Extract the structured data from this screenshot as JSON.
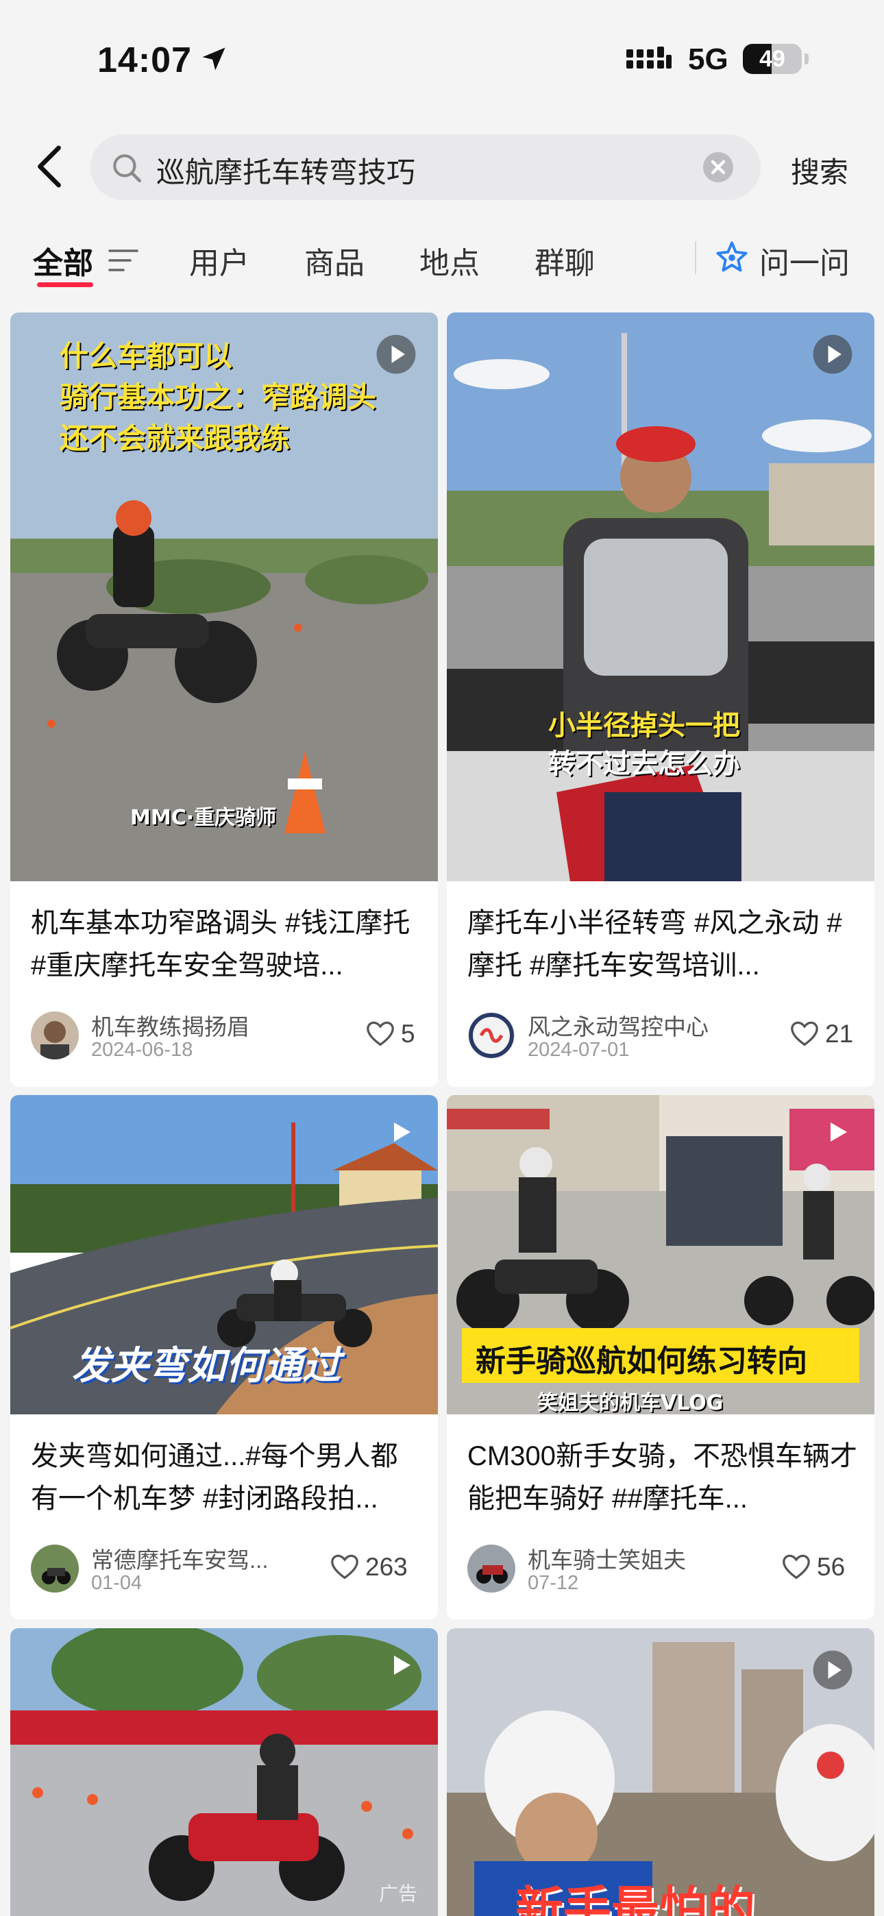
{
  "status_bar": {
    "time": "14:07",
    "network": "5G",
    "battery": "49",
    "battery_level": 0.49
  },
  "search": {
    "query": "巡航摩托车转弯技巧",
    "button_label": "搜索"
  },
  "tabs": [
    {
      "label": "全部",
      "active": true
    },
    {
      "label": "用户"
    },
    {
      "label": "商品"
    },
    {
      "label": "地点"
    },
    {
      "label": "群聊"
    }
  ],
  "ask_label": "问一问",
  "cards": [
    {
      "overlay_lines": [
        "什么车都可以",
        "骑行基本功之：窄路调头",
        "还不会就来跟我练"
      ],
      "watermark": "MMC·重庆骑师",
      "title": "机车基本功窄路调头 #钱江摩托  #重庆摩托车安全驾驶培...",
      "author": "机车教练揭扬眉",
      "date": "2024-06-18",
      "likes": "5"
    },
    {
      "overlay_lines": [
        "小半径掉头一把",
        "转不过去怎么办"
      ],
      "title": "摩托车小半径转弯 #风之永动  #摩托  #摩托车安驾培训...",
      "author": "风之永动驾控中心",
      "date": "2024-07-01",
      "likes": "21"
    },
    {
      "overlay_lines": [
        "发夹弯如何通过"
      ],
      "title": "发夹弯如何通过...#每个男人都有一个机车梦 #封闭路段拍...",
      "author": "常德摩托车安驾...",
      "date": "01-04",
      "likes": "263"
    },
    {
      "overlay_lines": [
        "新手骑巡航如何练习转向",
        "笑姐夫的机车VLOG"
      ],
      "title": "CM300新手女骑，不恐惧车辆才能把车骑好 ##摩托车...",
      "author": "机车骑士笑姐夫",
      "date": "07-12",
      "likes": "56"
    },
    {
      "ad_label": "广告"
    },
    {
      "overlay_lines": [
        "新手最怕的"
      ]
    }
  ]
}
